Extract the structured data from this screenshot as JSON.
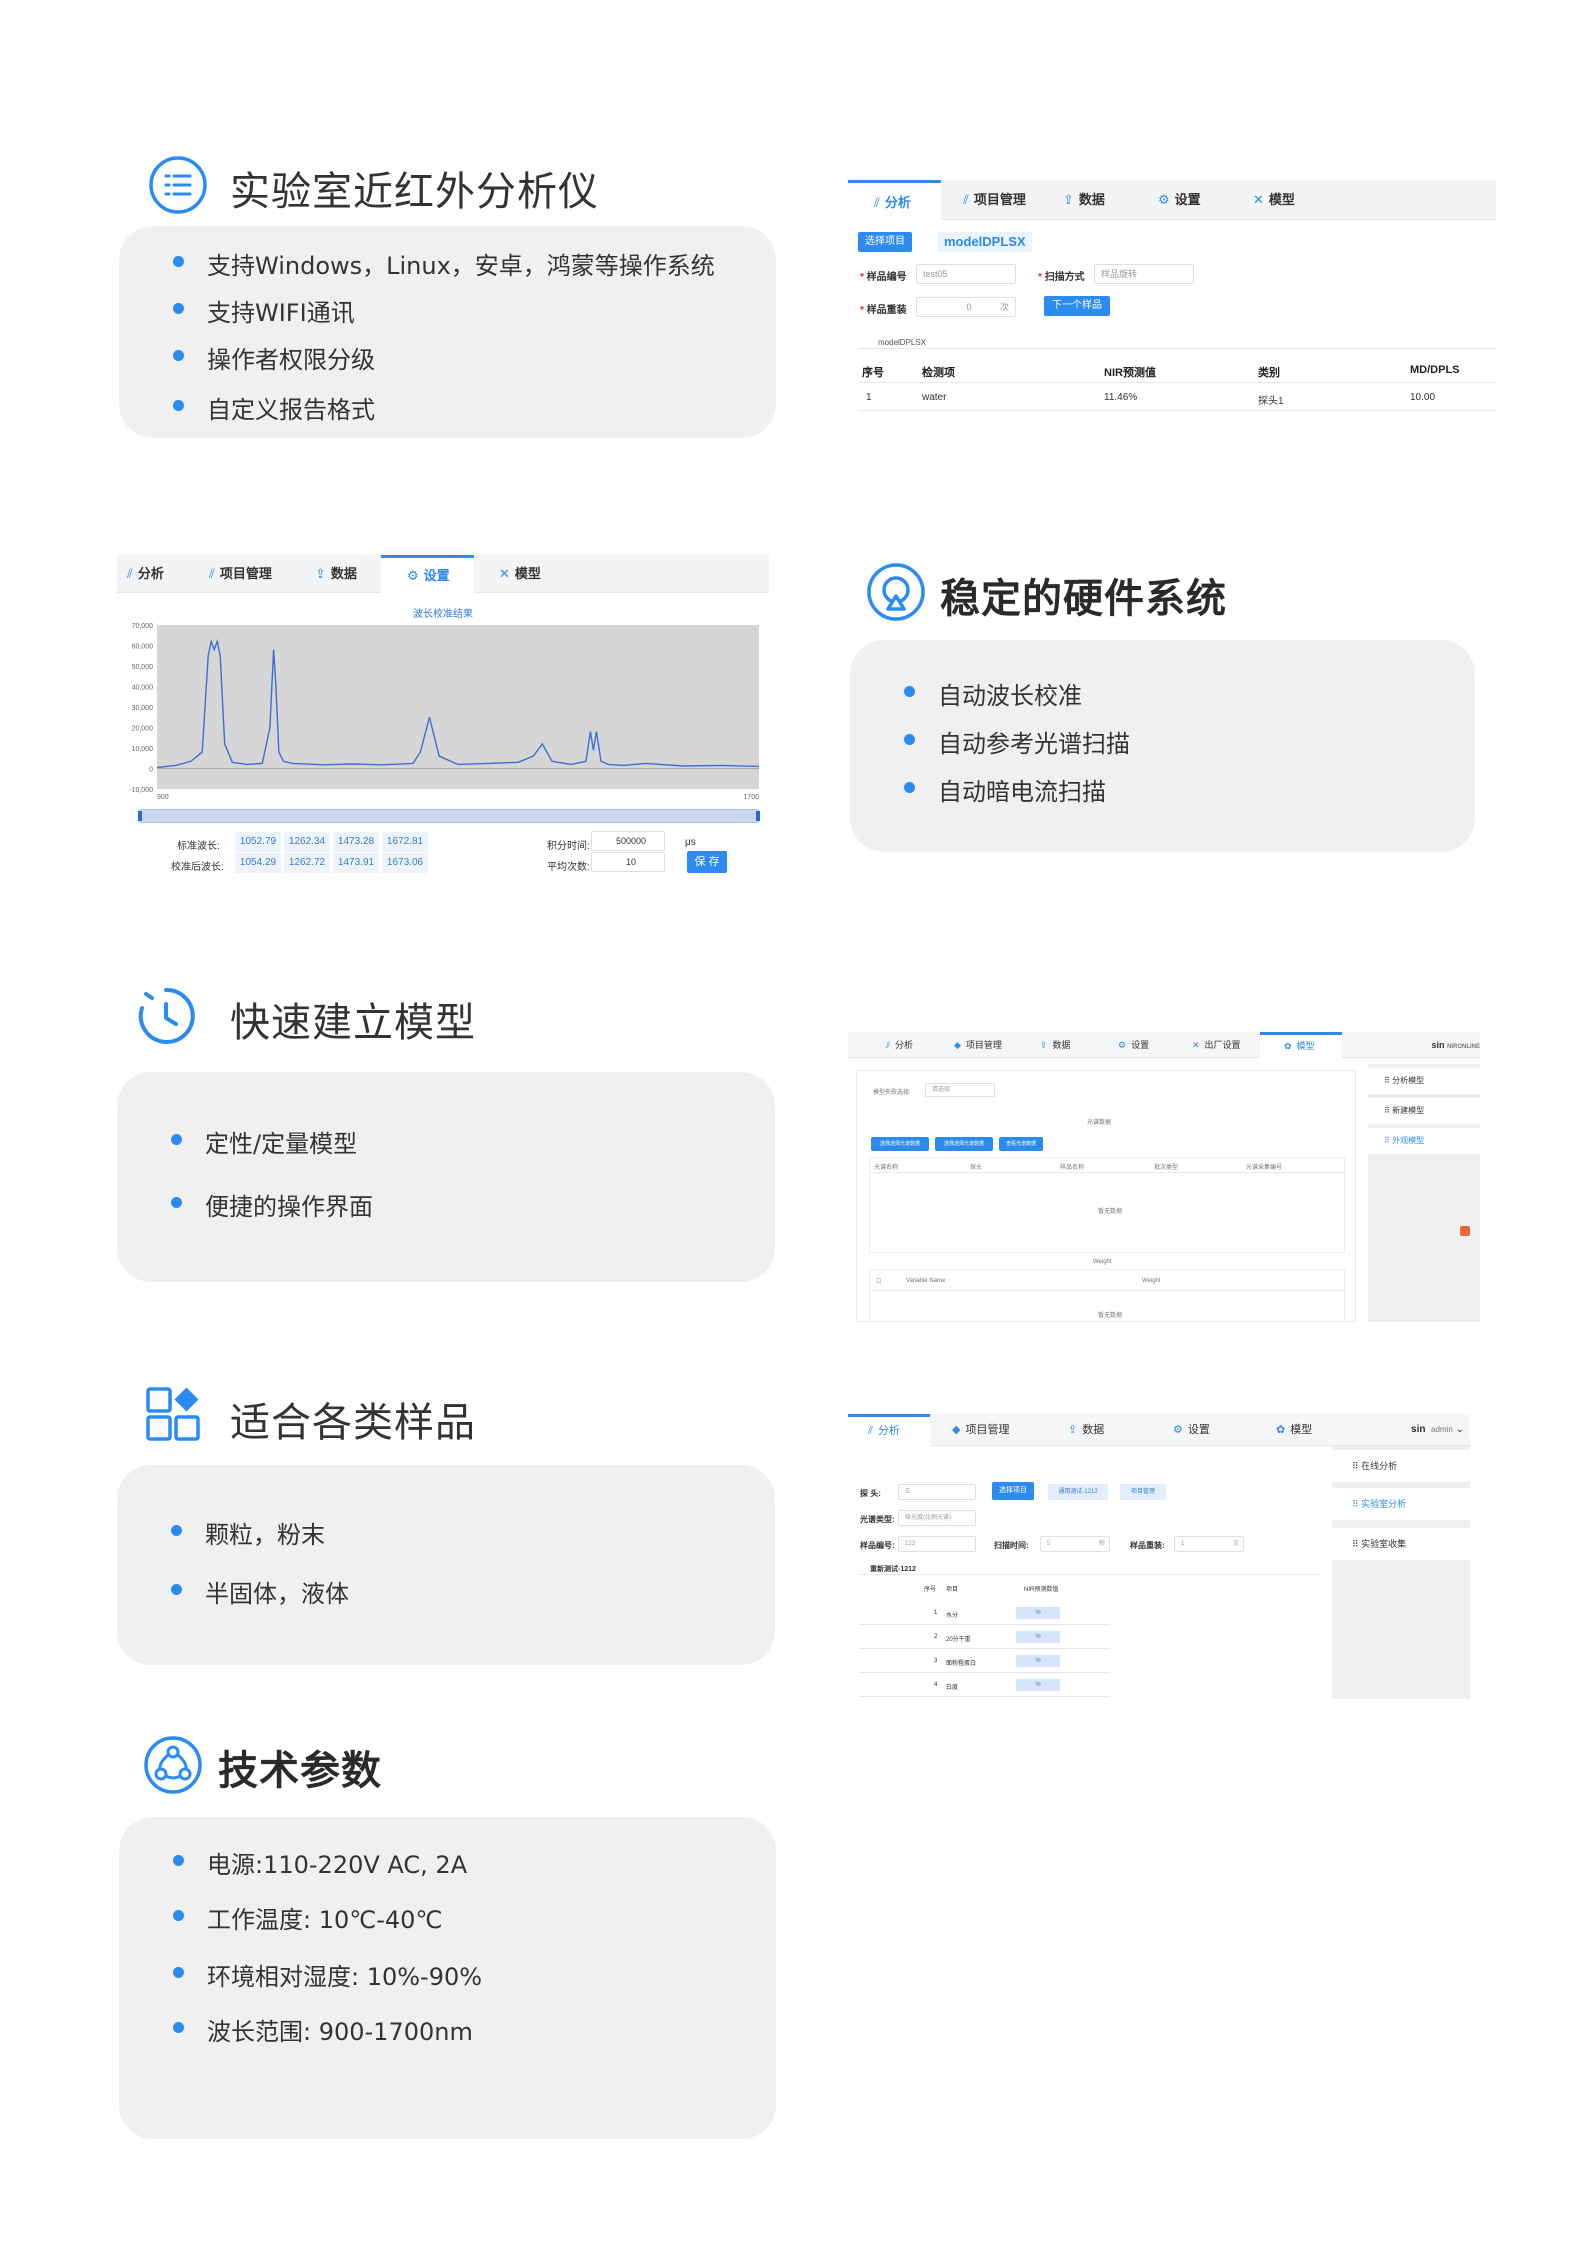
{
  "sections": {
    "s1": {
      "title": "实验室近红外分析仪",
      "items": [
        "支持Windows，Linux，安卓，鸿蒙等操作系统",
        "支持WIFI通讯",
        "操作者权限分级",
        "自定义报告格式"
      ]
    },
    "s2": {
      "title": "稳定的硬件系统",
      "items": [
        "自动波长校准",
        "自动参考光谱扫描",
        "自动暗电流扫描"
      ]
    },
    "s3": {
      "title": "快速建立模型",
      "items": [
        "定性/定量模型",
        "便捷的操作界面"
      ]
    },
    "s4": {
      "title": "适合各类样品",
      "items": [
        "颗粒，粉末",
        "半固体，液体"
      ]
    },
    "s5": {
      "title": "技术参数",
      "items": [
        "电源:110-220V AC, 2A",
        "工作温度: 10℃-40℃",
        "环境相对湿度: 10%-90%",
        "波长范围: 900-1700nm"
      ]
    }
  },
  "shot1": {
    "tabs": [
      "分析",
      "项目管理",
      "数据",
      "设置",
      "模型"
    ],
    "select_project": "选择项目",
    "model_name": "modelDPLSX",
    "sample_no_label": "样品编号",
    "sample_no_value": "test05",
    "scan_mode_label": "扫描方式",
    "scan_mode_value": "样品旋转",
    "weight_label": "样品重装",
    "weight_value": "0",
    "weight_unit": "次",
    "next_button": "下一个样品",
    "group": "modelDPLSX",
    "headers": [
      "序号",
      "检测项",
      "NIR预测值",
      "类别",
      "MD/DPLS"
    ],
    "rows": [
      [
        "1",
        "water",
        "11.46%",
        "探头1",
        "10.00"
      ]
    ]
  },
  "shot2": {
    "tabs": [
      "分析",
      "项目管理",
      "数据",
      "设置",
      "模型"
    ],
    "chart_data": {
      "type": "line",
      "title": "波长校准结果",
      "xlim": [
        900,
        1700
      ],
      "ylim": [
        -10000,
        70000
      ],
      "yticks": [
        "70,000",
        "60,000",
        "50,000",
        "40,000",
        "30,000",
        "20,000",
        "10,000",
        "0",
        "-10,000"
      ],
      "xticks": [
        "900",
        "1700"
      ],
      "x": [
        900,
        925,
        945,
        960,
        968,
        972,
        976,
        980,
        984,
        990,
        1000,
        1020,
        1040,
        1050,
        1055,
        1058,
        1062,
        1068,
        1080,
        1120,
        1160,
        1200,
        1240,
        1250,
        1262,
        1275,
        1300,
        1340,
        1380,
        1400,
        1412,
        1425,
        1450,
        1470,
        1476,
        1480,
        1484,
        1490,
        1500,
        1520,
        1550,
        1600,
        1650,
        1700
      ],
      "y": [
        500,
        1500,
        3500,
        8000,
        55000,
        62000,
        58000,
        62000,
        55000,
        12000,
        3000,
        2000,
        2500,
        20000,
        58000,
        40000,
        8000,
        3500,
        2500,
        1800,
        2200,
        1800,
        2500,
        8000,
        25000,
        6000,
        2000,
        2500,
        3000,
        6000,
        12000,
        3500,
        2000,
        3500,
        18000,
        9000,
        18000,
        3500,
        2000,
        1500,
        2500,
        1200,
        1500,
        1000
      ]
    },
    "std_label": "标准波长:",
    "std_values": [
      "1052.79",
      "1262.34",
      "1473.28",
      "1672.81"
    ],
    "cal_label": "校准后波长:",
    "cal_values": [
      "1054.29",
      "1262.72",
      "1473.91",
      "1673.06"
    ],
    "integ_label": "积分时间:",
    "integ_value": "500000",
    "integ_unit": "μs",
    "avg_label": "平均次数:",
    "avg_value": "10",
    "save": "保 存"
  },
  "shot3": {
    "tabs": [
      "分析",
      "项目管理",
      "数据",
      "设置",
      "出厂设置",
      "模型"
    ],
    "user": "sin",
    "user_extra": "NIRONLINE",
    "side": [
      "分析模型",
      "新建模型",
      "外观模型"
    ],
    "model_select_label": "模型失败选择:",
    "select_ph": "请选择",
    "group_title": "光谱数据",
    "btns": [
      "选择选择光谱数据",
      "选择选择光谱数据",
      "查看光谱数据"
    ],
    "table_cols": [
      "光谱名称",
      "探头",
      "样品名称",
      "批次类型",
      "光谱采集编号"
    ],
    "empty": "暂无数据",
    "weight_title": "Weight",
    "w_cols": [
      "Variable Name",
      "Weight"
    ]
  },
  "shot4": {
    "tabs": [
      "分析",
      "项目管理",
      "数据",
      "设置",
      "模型"
    ],
    "user": "sin",
    "admin": "admin",
    "side": [
      "在线分析",
      "实验室分析",
      "实验室收集"
    ],
    "probe_label": "探  头:",
    "probe_value": "S",
    "btn_select": "选择项目",
    "btn_group": "通用测试-1212",
    "btn_qc": "项目管理",
    "type_label": "光谱类型:",
    "type_value": "吸光度(比例光谱)",
    "no_label": "样品编号:",
    "no_value": "123",
    "scan_label": "扫描时间:",
    "scan_value": "5",
    "scan_unit": "秒",
    "rep_label": "样品重装:",
    "rep_value": "1",
    "rep_unit": "次",
    "group": "重新测试-1212",
    "cols": [
      "序号",
      "项目",
      "NIR预测数值"
    ],
    "rows": [
      [
        "1",
        "水分",
        "%"
      ],
      [
        "2",
        "20分干重",
        "%"
      ],
      [
        "3",
        "面粉粗蛋白",
        "%"
      ],
      [
        "4",
        "白度",
        "%"
      ]
    ]
  }
}
